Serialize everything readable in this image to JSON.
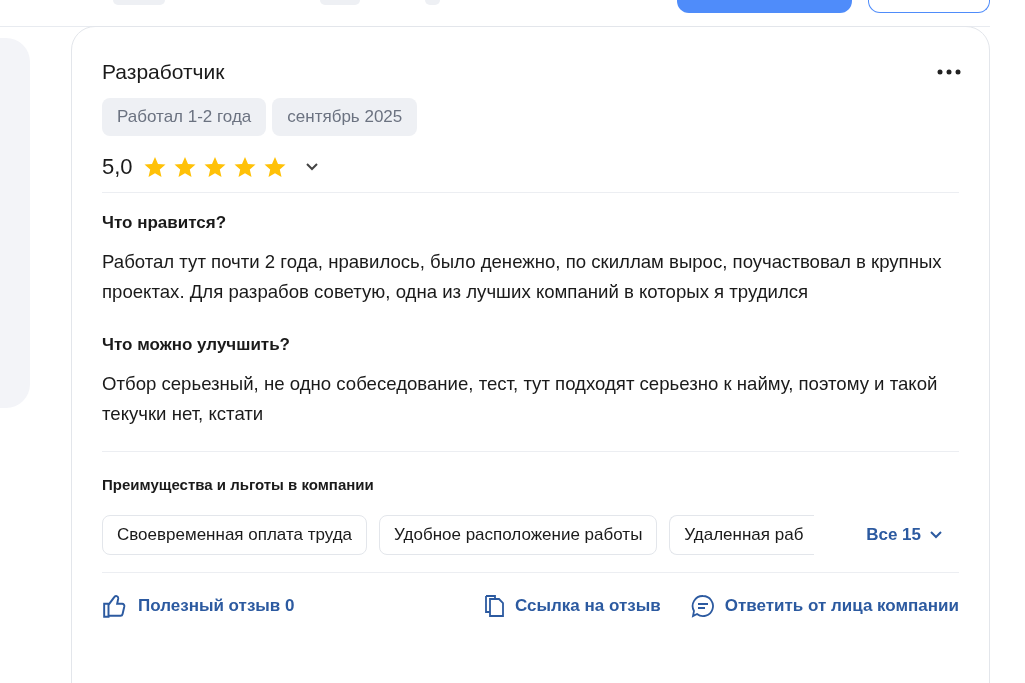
{
  "review": {
    "title": "Разработчик",
    "tags": [
      "Работал 1-2 года",
      "сентябрь 2025"
    ],
    "rating": "5,0",
    "stars": 5,
    "sections": [
      {
        "heading": "Что нравится?",
        "text": "Работал тут почти 2 года, нравилось, было денежно, по скиллам вырос, поучаствовал в крупных проектах. Для разрабов советую, одна из лучших компаний в которых я трудился"
      },
      {
        "heading": "Что можно улучшить?",
        "text": "Отбор серьезный, не одно собеседование, тест, тут подходят серьезно к найму, поэтому и такой текучки нет, кстати"
      }
    ],
    "benefits": {
      "heading": "Преимущества и льготы в компании",
      "items": [
        "Своевременная оплата труда",
        "Удобное расположение работы",
        "Удаленная раб"
      ],
      "more": "Все 15"
    },
    "actions": {
      "helpful": "Полезный отзыв 0",
      "link": "Ссылка на отзыв",
      "reply": "Ответить от лица компании"
    }
  }
}
